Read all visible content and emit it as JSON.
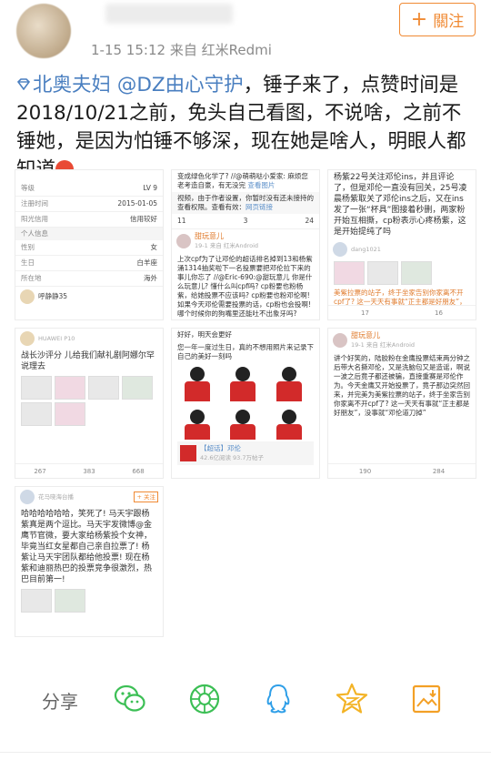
{
  "header": {
    "meta_time": "1-15 15:12",
    "meta_source": "来自 红米Redmi",
    "follow_label": "關注",
    "follow_plus": "+"
  },
  "post": {
    "mention_1": "北奥夫妇",
    "mention_2": "@DZ由心守护",
    "body": "，锤子来了，点赞时间是2018/10/21之前，免头自己看图，不说啥，之前不锤她，是因为怕锤不够深，现在她是啥人，明眼人都知道",
    "accent_color": "#4a7fc0"
  },
  "tile1": {
    "rows": [
      {
        "k": "等级",
        "v": "LV 9"
      },
      {
        "k": "注册时间",
        "v": "2015-01-05"
      },
      {
        "k": "阳光信用",
        "v": "信用较好"
      }
    ],
    "section": "个人信息",
    "rows2": [
      {
        "k": "性别",
        "v": "女"
      },
      {
        "k": "生日",
        "v": "白羊座"
      },
      {
        "k": "所在地",
        "v": "海外"
      }
    ],
    "user": "呼静静35"
  },
  "tile2": {
    "top_text": "变成绿色化学了? //@萌萌哒小爱家: 麻烦您老考造自豪，有无没完",
    "link": "查看图片",
    "note": "视频，由于作者设置，你暂时没有还未接持的查看权限。查看有效：",
    "link2": "网页链接",
    "counts": [
      "11",
      "3",
      "24"
    ],
    "user": "甜玩意儿",
    "user_sub": "19-1 来自 红米Android",
    "body": "上次cpf为了让邓伦的超话排名掉到13和杨紫涌1314抽奖啦下一名投票要把邓伦拉下来的事儿你忘了 //@Eric-690:@甜玩意儿 你是什么玩意儿? 懂什么叫cpf吗? cp粉要也粉杨紫，给她投票不应该吗? cp粉要也粉邓伦啊! 如果今天邓伦需要投票的话，cp粉也会投啊! 哪个时候你的狗嘴里还能吐不出象牙吗?"
  },
  "tile3": {
    "body": "杨紫22号关注邓伦ins，并且评论了，但是邓伦一直没有回关，25号凌晨杨紫取关了邓伦ins之后，又在ins发了一张“杯具”图接着秒删，两家粉开始互相撕，cp粉表示心疼杨紫，这是开始提纯了吗",
    "user": "dang1021",
    "footer": "美紫拉票的站子，终于坐家告别你家离不开cpf了? 这一天天有事就“正主都是好朋友”，谢谢邓伦点刀掉",
    "counts": [
      "17",
      "16"
    ]
  },
  "tile4": {
    "user": "HUAWEI P10",
    "body": "战长沙评分 儿给我们献礼剧阿娜尔罕说理去",
    "counts": [
      "267",
      "383",
      "668"
    ]
  },
  "tile5": {
    "top": "好好，明天会更好",
    "body": "您一年一度过生日，真的不想用照片来记录下自己的美好一刻吗",
    "channel_tag": "【超话】邓伦",
    "channel_sub": "42.6亿阅读 93.7万帖子"
  },
  "tile6": {
    "user": "甜玩意儿",
    "user_sub": "19-1 来自 红米Android",
    "body": "讲个好笑的，陆胶粉在金鹰投票结束两分钟之后带大名撕邓伦，又是洗脑包又是造谣，啊说一波之后竟子都还被骗，直接重赛是邓伦作为。今天金鹰又开始投票了，竟子那边突然回来，并完美为美紫拉票的站子，终于坐家告别你家离不开cpf了? 这一天天有事就“正主都是好朋友”，没事就“邓伦道刀掉”",
    "counts": [
      "190",
      "284"
    ]
  },
  "tile7": {
    "user": "花马晓海台播",
    "follow": "+ 关注",
    "body": "哈哈哈哈哈哈，笑死了! 马天宇跟杨紫真是两个逗比。马天宇发微博@金鹰节官微，要大家给杨紫投个女神，毕竟当红女星都自己亲自拉票了! 杨紫让马天宇团队都给他投票! 现在杨紫和迪丽热巴的投票竞争很激烈，热巴目前第一!"
  },
  "share": {
    "label": "分享",
    "icons": [
      "wechat-icon",
      "moments-icon",
      "weibo-icon",
      "qq-icon",
      "qzone-icon",
      "save-image-icon"
    ]
  }
}
